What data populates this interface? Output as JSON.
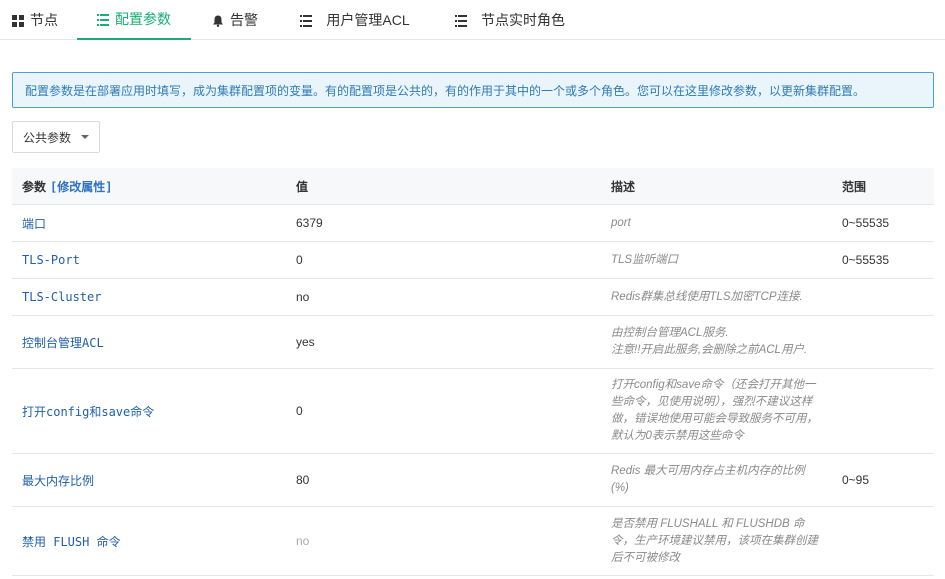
{
  "tabs": [
    {
      "label": "节点",
      "icon": "grid-icon",
      "active": false
    },
    {
      "label": "配置参数",
      "icon": "list-icon",
      "active": true
    },
    {
      "label": "告警",
      "icon": "bell-icon",
      "active": false
    },
    {
      "label": "用户管理ACL",
      "icon": "list-icon",
      "active": false
    },
    {
      "label": "节点实时角色",
      "icon": "list-icon",
      "active": false
    }
  ],
  "alert": {
    "text": "配置参数是在部署应用时填写，成为集群配置项的变量。有的配置项是公共的，有的作用于其中的一个或多个角色。您可以在这里修改参数，以更新集群配置。"
  },
  "filter": {
    "selected": "公共参数"
  },
  "table": {
    "headers": {
      "param": "参数",
      "edit_link": "[修改属性]",
      "value": "值",
      "desc": "描述",
      "range": "范围"
    },
    "rows": [
      {
        "param": "端口",
        "value": "6379",
        "desc": "port",
        "range": "0~55535"
      },
      {
        "param": "TLS-Port",
        "value": "0",
        "desc": "TLS监听端口",
        "range": "0~55535"
      },
      {
        "param": "TLS-Cluster",
        "value": "no",
        "desc": "Redis群集总线使用TLS加密TCP连接.",
        "range": ""
      },
      {
        "param": "控制台管理ACL",
        "value": "yes",
        "desc_line1": "由控制台管理ACL服务.",
        "desc_line2": "注意!!开启此服务,会删除之前ACL用户.",
        "range": ""
      },
      {
        "param": "打开config和save命令",
        "value": "0",
        "desc": "打开config和save命令（还会打开其他一些命令，见使用说明），强烈不建议这样做，错误地使用可能会导致服务不可用，默认为0表示禁用这些命令",
        "range": ""
      },
      {
        "param": "最大内存比例",
        "value": "80",
        "desc": "Redis 最大可用内存占主机内存的比例(%)",
        "range": "0~95"
      },
      {
        "param": "禁用 FLUSH 命令",
        "value": "no",
        "desc": "是否禁用 FLUSHALL 和 FLUSHDB 命令，生产环境建议禁用，该项在集群创建后不可被修改",
        "range": ""
      }
    ]
  },
  "colors": {
    "accent": "#1aad74",
    "link": "#1f5fa8",
    "alert_border": "#4aa3d6",
    "alert_bg": "#eaf4fb"
  }
}
